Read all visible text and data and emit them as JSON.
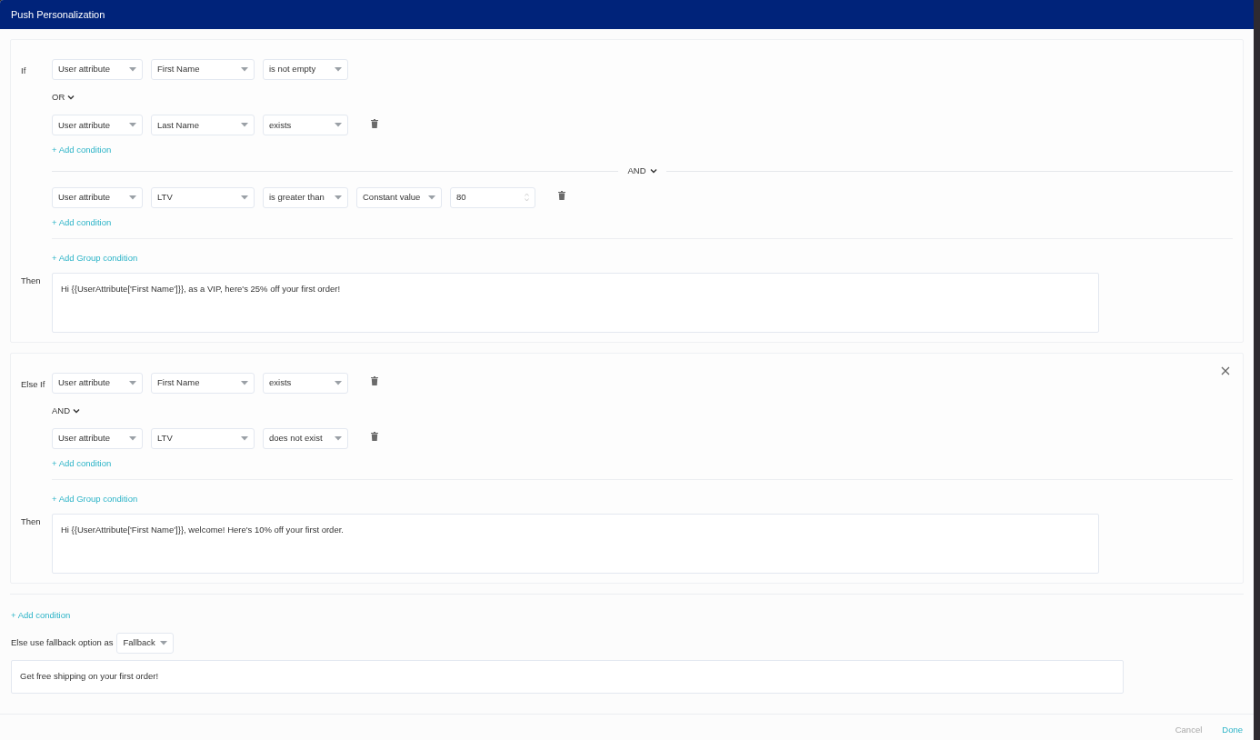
{
  "dialog": {
    "title": "Push Personalization"
  },
  "blocks": [
    {
      "label": "If",
      "closable": false,
      "groups": [
        {
          "conditions": [
            {
              "deletable": false,
              "fields": [
                {
                  "kind": "select",
                  "value": "User attribute"
                },
                {
                  "kind": "select",
                  "value": "First Name"
                },
                {
                  "kind": "select",
                  "value": "is not empty"
                }
              ]
            },
            {
              "deletable": true,
              "fields": [
                {
                  "kind": "select",
                  "value": "User attribute"
                },
                {
                  "kind": "select",
                  "value": "Last Name"
                },
                {
                  "kind": "select",
                  "value": "exists"
                }
              ]
            }
          ],
          "connectors": [
            "OR"
          ],
          "add_condition": "+ Add condition"
        },
        {
          "conditions": [
            {
              "deletable": true,
              "fields": [
                {
                  "kind": "select",
                  "value": "User attribute"
                },
                {
                  "kind": "select",
                  "value": "LTV"
                },
                {
                  "kind": "select",
                  "value": "is greater than"
                },
                {
                  "kind": "select",
                  "value": "Constant value"
                },
                {
                  "kind": "number",
                  "value": "80"
                }
              ]
            }
          ],
          "add_condition": "+ Add condition"
        }
      ],
      "group_connectors": [
        "AND"
      ],
      "add_group_condition": "+ Add Group condition",
      "then_label": "Then",
      "message": "Hi {{UserAttribute['First Name']}}, as a VIP, here's 25% off your first order!"
    },
    {
      "label": "Else If",
      "closable": true,
      "groups": [
        {
          "conditions": [
            {
              "deletable": true,
              "fields": [
                {
                  "kind": "select",
                  "value": "User attribute"
                },
                {
                  "kind": "select",
                  "value": "First Name"
                },
                {
                  "kind": "select",
                  "value": "exists"
                }
              ]
            },
            {
              "deletable": true,
              "fields": [
                {
                  "kind": "select",
                  "value": "User attribute"
                },
                {
                  "kind": "select",
                  "value": "LTV"
                },
                {
                  "kind": "select",
                  "value": "does not exist"
                }
              ]
            }
          ],
          "connectors": [
            "AND"
          ],
          "add_condition": "+ Add condition"
        }
      ],
      "add_group_condition": "+ Add Group condition",
      "then_label": "Then",
      "message": "Hi {{UserAttribute['First Name']}}, welcome! Here's 10% off your first order."
    }
  ],
  "add_condition": "+ Add condition",
  "fallback": {
    "label": "Else use fallback option as",
    "select": "Fallback",
    "message": "Get free shipping on your first order!"
  },
  "footer": {
    "buttons": [
      {
        "label": "Cancel",
        "kind": "secondary"
      },
      {
        "label": "Done",
        "kind": "primary"
      }
    ]
  }
}
